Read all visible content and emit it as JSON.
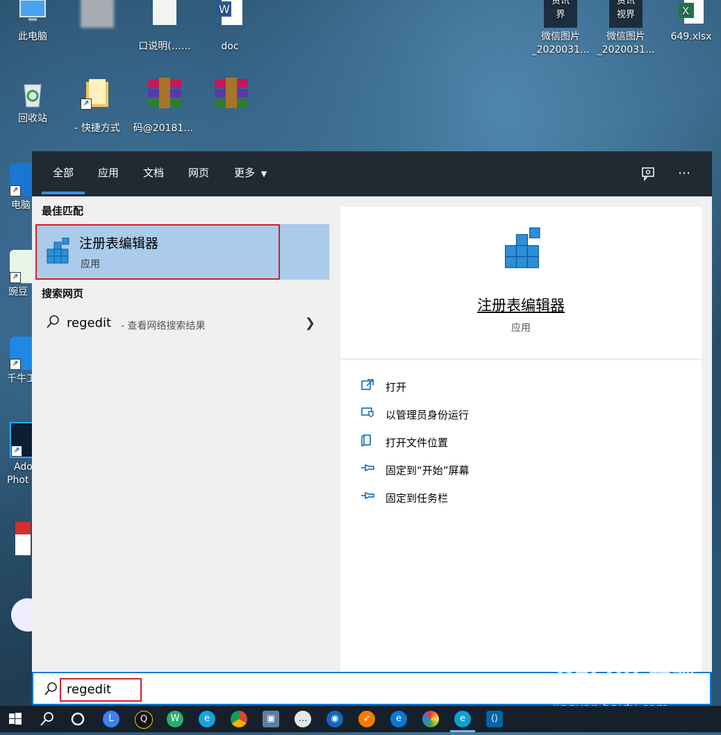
{
  "desktop": {
    "this_pc": "此电脑",
    "recycle_bin": "回收站",
    "doc_file": "doc",
    "blurred_file_1": "口说明(……",
    "shortcut_label": "- 快捷方式",
    "archive_label": "码@20181…",
    "wechat_img_1": [
      "微信图片",
      "_2020031..."
    ],
    "wechat_img_2": [
      "微信图片",
      "_2020031..."
    ],
    "excel_file": "649.xlsx",
    "news_1": [
      "资讯",
      "界"
    ],
    "news_2": [
      "资讯",
      "视界"
    ],
    "left_col_1": "电脑",
    "left_col_2": "豌豆",
    "left_col_3": "千牛工",
    "left_col_4": [
      "Ado",
      "Phot"
    ]
  },
  "tabs": [
    "全部",
    "应用",
    "文档",
    "网页",
    "更多"
  ],
  "best_match": {
    "section": "最佳匹配",
    "name": "注册表编辑器",
    "kind": "应用"
  },
  "web": {
    "section": "搜索网页",
    "query": "regedit",
    "suffix": " - 查看网络搜索结果"
  },
  "detail": {
    "name": "注册表编辑器",
    "kind": "应用",
    "actions": [
      "打开",
      "以管理员身份运行",
      "打开文件位置",
      "固定到“开始”屏幕",
      "固定到任务栏"
    ]
  },
  "search": {
    "value": "regedit"
  },
  "watermark": {
    "brand": "Bai du 经验",
    "url": "jingyan.baidu.com"
  },
  "taskbar_icons": [
    "windows-start-icon",
    "search-icon",
    "cortana-icon",
    "app-l-icon",
    "qq-icon",
    "wechat-icon",
    "ie-icon",
    "chrome-icon",
    "remote-icon",
    "chat-icon",
    "maps-icon",
    "compass-icon",
    "edge-icon",
    "palette-icon",
    "edge-beta-icon",
    "vscode-icon"
  ]
}
